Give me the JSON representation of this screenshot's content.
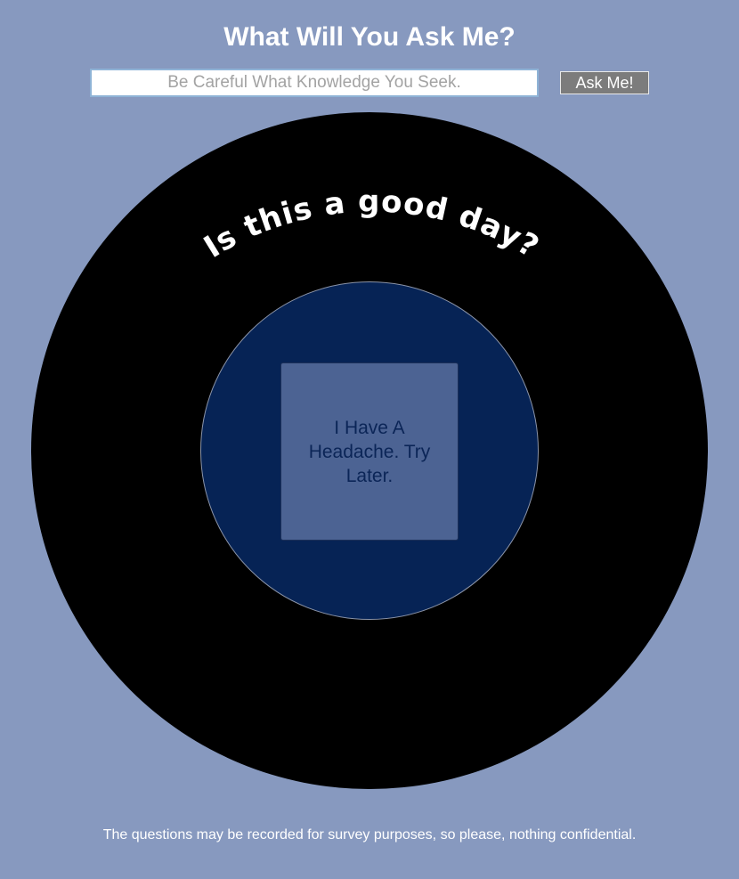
{
  "header": {
    "title": "What Will You Ask Me?"
  },
  "question_form": {
    "placeholder": "Be Careful What Knowledge You Seek.",
    "value": "",
    "ask_button_label": "Ask Me!"
  },
  "eight_ball": {
    "asked_question": "Is this a good day?",
    "answer": "I Have A Headache. Try Later."
  },
  "footer": {
    "disclaimer": "The questions may be recorded for survey purposes, so please, nothing confidential."
  },
  "colors": {
    "page_background": "#8799bf",
    "ball": "#000000",
    "window": "#062355",
    "answer_die": "#4c6393",
    "answer_text": "#0b2557",
    "button": "#7c7c7c"
  }
}
